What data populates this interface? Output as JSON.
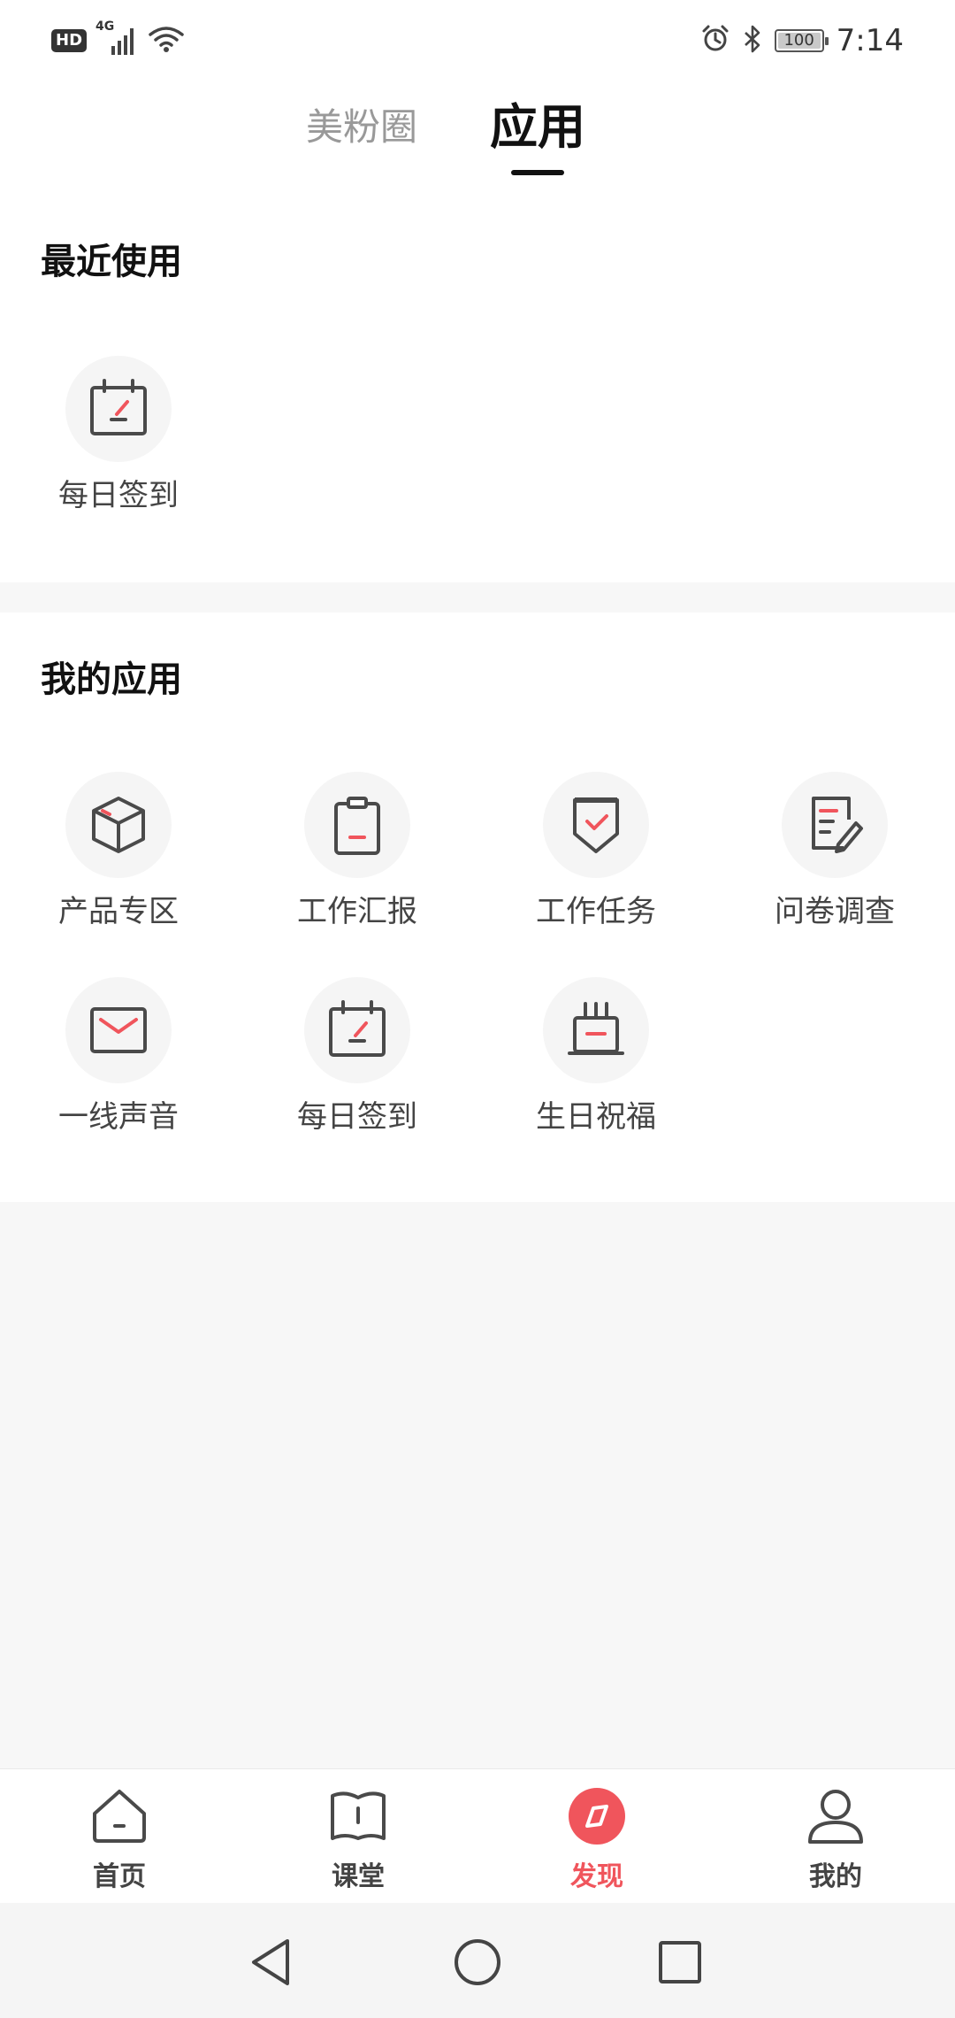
{
  "status_bar": {
    "hd": "HD",
    "network": "4G",
    "battery": "100",
    "battery_level": 1.0,
    "time": "7:14"
  },
  "top_tabs": {
    "tab1": "美粉圈",
    "tab2": "应用",
    "active": "应用"
  },
  "recent": {
    "title": "最近使用",
    "items": [
      {
        "label": "每日签到",
        "icon": "calendar-sign-icon"
      }
    ]
  },
  "my_apps": {
    "title": "我的应用",
    "items": [
      {
        "label": "产品专区",
        "icon": "cube-icon"
      },
      {
        "label": "工作汇报",
        "icon": "clipboard-icon"
      },
      {
        "label": "工作任务",
        "icon": "shield-check-icon"
      },
      {
        "label": "问卷调查",
        "icon": "survey-pen-icon"
      },
      {
        "label": "一线声音",
        "icon": "mail-icon"
      },
      {
        "label": "每日签到",
        "icon": "calendar-sign-icon"
      },
      {
        "label": "生日祝福",
        "icon": "cake-icon"
      }
    ]
  },
  "bottom_nav": {
    "items": [
      {
        "label": "首页",
        "icon": "home-icon"
      },
      {
        "label": "课堂",
        "icon": "book-icon"
      },
      {
        "label": "发现",
        "icon": "compass-icon"
      },
      {
        "label": "我的",
        "icon": "user-icon"
      }
    ],
    "active": "发现"
  },
  "colors": {
    "accent": "#f0555c",
    "icon_dark": "#4a4a4a",
    "band": "#f7f7f7"
  }
}
